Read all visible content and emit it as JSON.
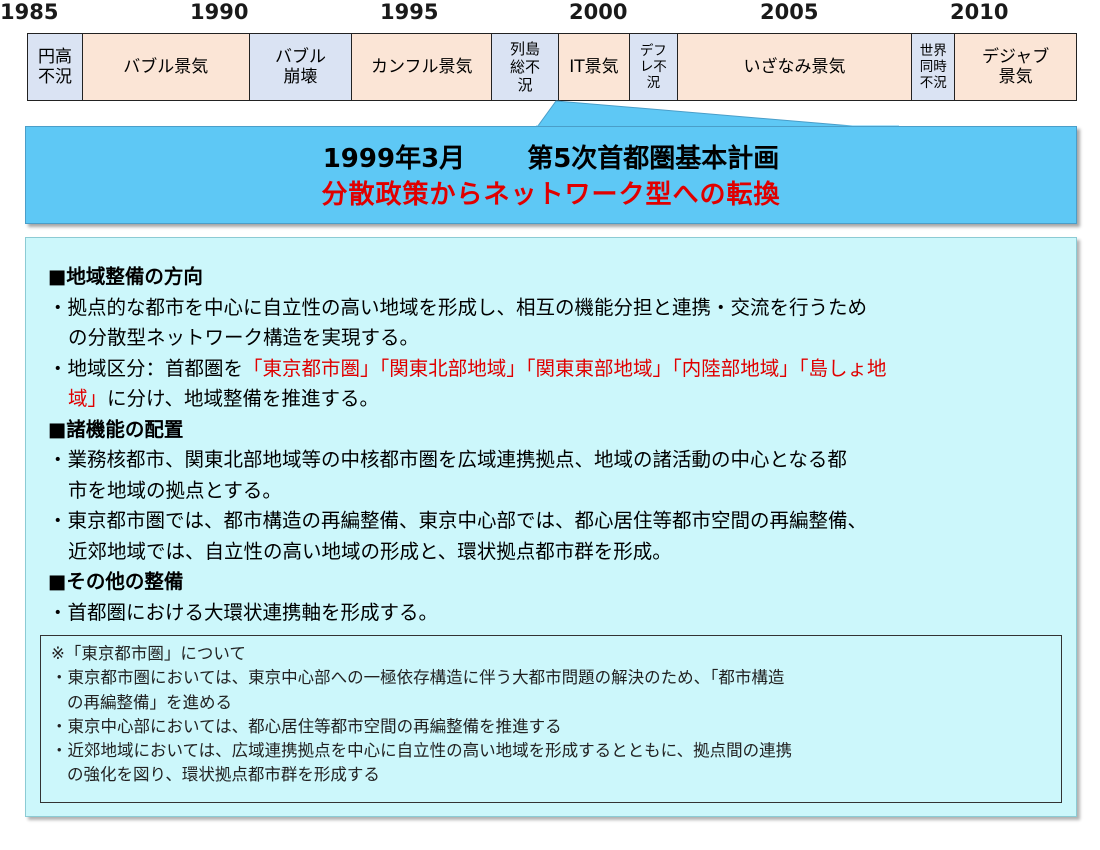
{
  "years": [
    "1985",
    "1990",
    "1995",
    "2000",
    "2005",
    "2010"
  ],
  "timeline": [
    {
      "label": "円高\n不況",
      "kind": "slump"
    },
    {
      "label": "バブル景気",
      "kind": "boom"
    },
    {
      "label": "バブル\n崩壊",
      "kind": "slump"
    },
    {
      "label": "カンフル景気",
      "kind": "boom"
    },
    {
      "label": "列島\n総不\n況",
      "kind": "slump"
    },
    {
      "label": "IT景気",
      "kind": "boom"
    },
    {
      "label": "デフ\nレ不\n況",
      "kind": "slump"
    },
    {
      "label": "いざなみ景気",
      "kind": "boom"
    },
    {
      "label": "世界\n同時\n不況",
      "kind": "slump"
    },
    {
      "label": "デジャブ\n景気",
      "kind": "boom"
    }
  ],
  "banner": {
    "date": "1999年3月",
    "plan": "第5次首都圏基本計画",
    "subtitle": "分散政策からネットワーク型への転換"
  },
  "sections": {
    "s1_title": "■地域整備の方向",
    "s1_b1_l1": "・拠点的な都市を中心に自立性の高い地域を形成し、相互の機能分担と連携・交流を行うため",
    "s1_b1_l2": "の分散型ネットワーク構造を実現する。",
    "s1_b2_pre": "・地域区分：首都圏を",
    "s1_b2_red1": "「東京都市圏」「関東北部地域」「関東東部地域」「内陸部地域」「島しょ地",
    "s1_b2_red2": "域」",
    "s1_b2_post": "に分け、地域整備を推進する。",
    "s2_title": "■諸機能の配置",
    "s2_b1_l1": "・業務核都市、関東北部地域等の中核都市圏を広域連携拠点、地域の諸活動の中心となる都",
    "s2_b1_l2": "市を地域の拠点とする。",
    "s2_b2_l1": "・東京都市圏では、都市構造の再編整備、東京中心部では、都心居住等都市空間の再編整備、",
    "s2_b2_l2": "近郊地域では、自立性の高い地域の形成と、環状拠点都市群を形成。",
    "s3_title": "■その他の整備",
    "s3_b1": "・首都圏における大環状連携軸を形成する。"
  },
  "note": {
    "title": "※「東京都市圏」について",
    "b1_l1": "・東京都市圏においては、東京中心部への一極依存構造に伴う大都市問題の解決のため、「都市構造",
    "b1_l2": "の再編整備」を進める",
    "b2": "・東京中心部においては、都心居住等都市空間の再編整備を推進する",
    "b3_l1": "・近郊地域においては、広域連携拠点を中心に自立性の高い地域を形成するとともに、拠点間の連携",
    "b3_l2": "の強化を図り、環状拠点都市群を形成する"
  },
  "colors": {
    "boom": "#fbe5d6",
    "slump": "#dae3f3",
    "banner": "#5ec8f5",
    "panel": "#ccf7fb",
    "accent_red": "#e00000"
  }
}
